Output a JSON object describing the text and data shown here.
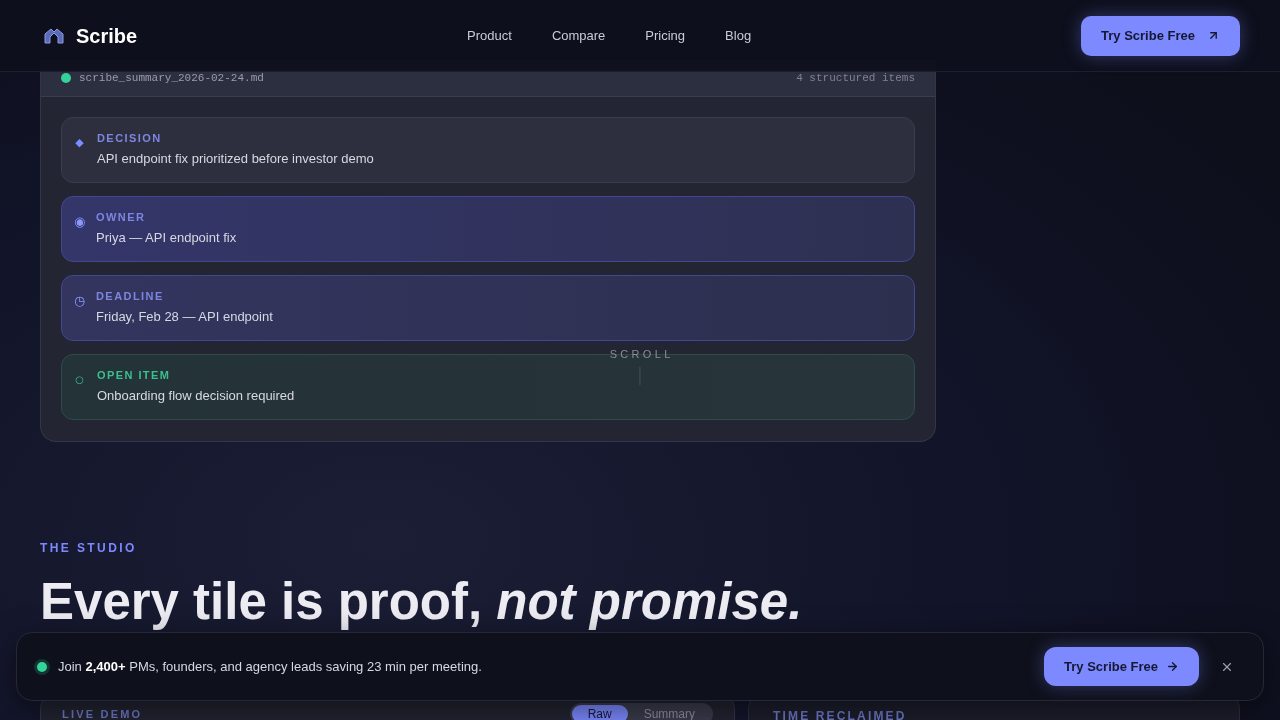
{
  "header": {
    "brand": "Scribe",
    "nav": [
      "Product",
      "Compare",
      "Pricing",
      "Blog"
    ],
    "cta": "Try Scribe Free"
  },
  "summary_card": {
    "file_name": "scribe_summary_2026-02-24.md",
    "item_count": "4 structured items",
    "items": [
      {
        "kind": "decision",
        "icon": "◆",
        "label": "DECISION",
        "text": "API endpoint fix prioritized before investor demo"
      },
      {
        "kind": "owner",
        "icon": "◉",
        "label": "OWNER",
        "text": "Priya — API endpoint fix"
      },
      {
        "kind": "deadline",
        "icon": "◷",
        "label": "DEADLINE",
        "text": "Friday, Feb 28 — API endpoint"
      },
      {
        "kind": "open_item",
        "icon": "○",
        "label": "OPEN ITEM",
        "text": "Onboarding flow decision required"
      }
    ]
  },
  "scroll_hint": "SCROLL",
  "studio": {
    "eyebrow": "THE STUDIO",
    "heading": "Every tile is proof, *not promise.*"
  },
  "demo_card": {
    "label": "LIVE DEMO",
    "toggle": [
      {
        "label": "Raw",
        "selected": true
      },
      {
        "label": "Summary",
        "selected": false
      }
    ]
  },
  "stats_card": {
    "label": "TIME RECLAIMED"
  },
  "banner": {
    "text": "Join **2,400+** PMs, founders, and agency leads saving 23 min per meeting.",
    "cta": "Try Scribe Free"
  }
}
